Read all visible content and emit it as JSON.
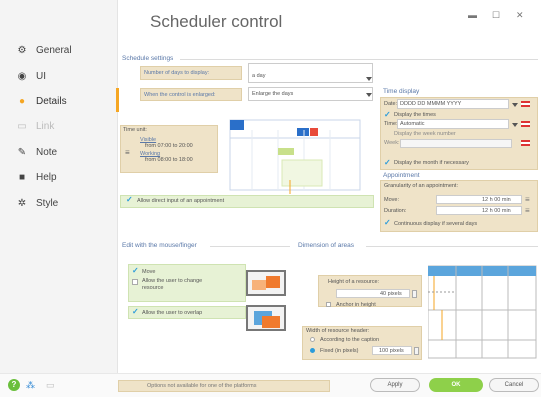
{
  "title": "Scheduler control",
  "sidebar": {
    "items": [
      {
        "label": "General",
        "icon": "gear-icon"
      },
      {
        "label": "UI",
        "icon": "ui-icon"
      },
      {
        "label": "Details",
        "icon": "details-icon"
      },
      {
        "label": "Link",
        "icon": "link-icon"
      },
      {
        "label": "Note",
        "icon": "note-icon"
      },
      {
        "label": "Help",
        "icon": "help-icon"
      },
      {
        "label": "Style",
        "icon": "style-icon"
      }
    ]
  },
  "schedule": {
    "section_label": "Schedule settings",
    "days_label": "Number of days to display:",
    "days_value": "a day",
    "enlarged_label": "When the control is enlarged:",
    "enlarged_value": "Enlarge the days",
    "time_unit_label": "Time unit:",
    "visible_label": "Visible",
    "visible_range": "from 07:00 to 20:00",
    "working_label": "Working",
    "working_range": "from 08:00 to 18:00",
    "direct_input_label": "Allow direct input of an appointment"
  },
  "time_display": {
    "section_label": "Time display",
    "date_label": "Date:",
    "date_value": "DDDD DD MMMM YYYY",
    "display_times": "Display the times",
    "time_label": "Time:",
    "time_value": "Automatic",
    "display_week": "Display the week number",
    "week_label": "Week:",
    "week_value": "",
    "week_hint": "",
    "display_month": "Display the month if necessary"
  },
  "appointment": {
    "section_label": "Appointment",
    "granularity_label": "Granularity of an appointment:",
    "move_label": "Move:",
    "move_value": "12 h 00 min",
    "duration_label": "Duration:",
    "duration_value": "12 h 00 min",
    "continuous_label": "Continuous display if several days"
  },
  "edit": {
    "section_label": "Edit with the mouse/finger",
    "move_label": "Move",
    "change_resource_label": "Allow the user to change resource",
    "overlap_label": "Allow the user to overlap"
  },
  "dimension": {
    "section_label": "Dimension of areas",
    "height_label": "Height of a resource:",
    "height_value": "40 pixels",
    "anchor_label": "Anchor in height",
    "width_label": "Width of resource header:",
    "caption_option": "According to the caption",
    "fixed_option": "Fixed (in pixels)",
    "fixed_value": "100 pixels"
  },
  "footer": {
    "note": "Options not available for one of the platforms",
    "apply": "Apply",
    "ok": "OK",
    "cancel": "Cancel"
  },
  "colors": {
    "accent": "#f5a623",
    "ok_green": "#8ed04a",
    "section_blue": "#5a78a8"
  }
}
